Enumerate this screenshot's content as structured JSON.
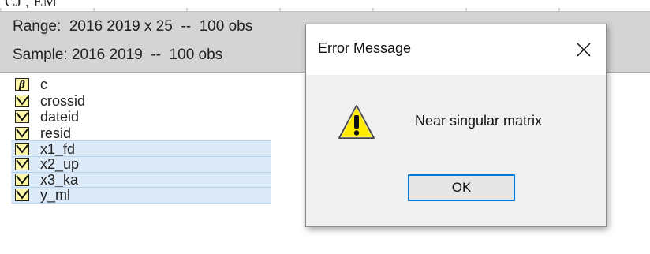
{
  "window": {
    "title_cropped": "CJ , EM"
  },
  "header": {
    "range": "Range:  2016 2019 x 25  --  100 obs",
    "sample": "Sample: 2016 2019  --  100 obs"
  },
  "workfile": {
    "items": [
      {
        "label": "c",
        "icon": "coefficient-icon",
        "selected": false
      },
      {
        "label": "crossid",
        "icon": "series-icon",
        "selected": false
      },
      {
        "label": "dateid",
        "icon": "series-icon",
        "selected": false
      },
      {
        "label": "resid",
        "icon": "series-icon",
        "selected": false
      },
      {
        "label": "x1_fd",
        "icon": "series-icon",
        "selected": true
      },
      {
        "label": "x2_up",
        "icon": "series-icon",
        "selected": true
      },
      {
        "label": "x3_ka",
        "icon": "series-icon",
        "selected": true
      },
      {
        "label": "y_ml",
        "icon": "series-icon",
        "selected": true
      }
    ]
  },
  "dialog": {
    "title": "Error Message",
    "message": "Near singular matrix",
    "ok_label": "OK",
    "icon": "warning-icon"
  },
  "colors": {
    "header_bg": "#d4d4d4",
    "selection_bg": "#dceaf7",
    "ok_border": "#0078d7",
    "warning_yellow": "#ffea00"
  }
}
